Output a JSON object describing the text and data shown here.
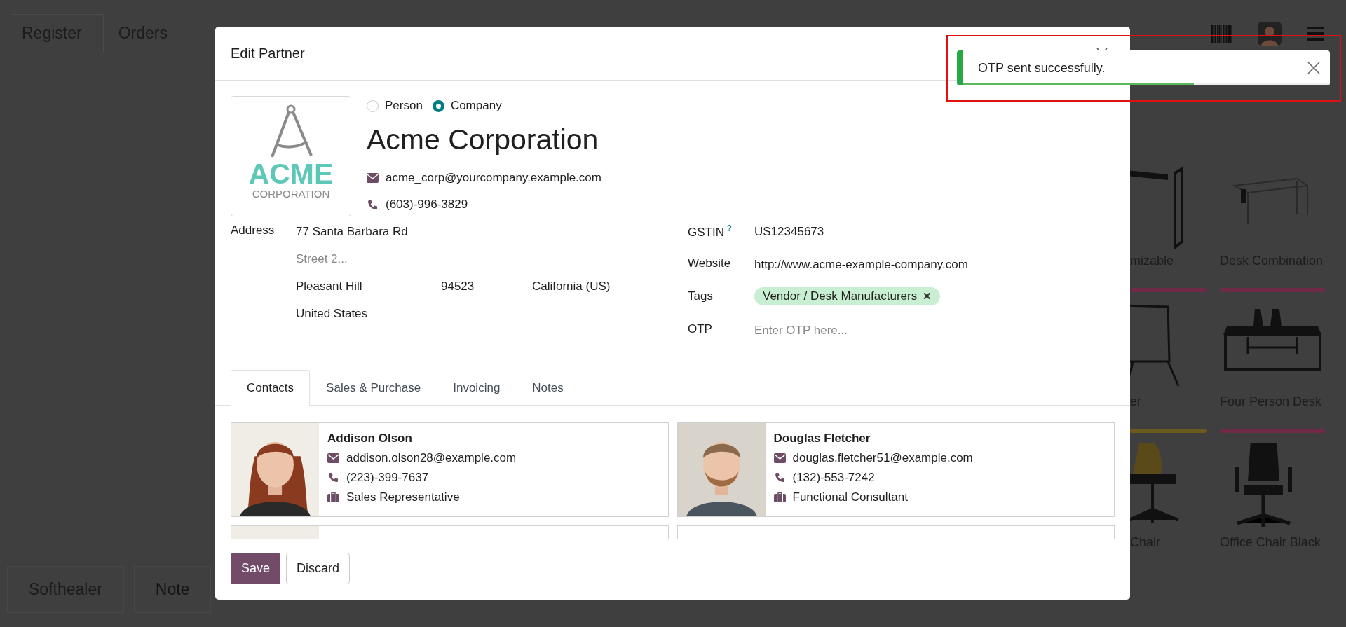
{
  "background": {
    "top_tabs": [
      {
        "label": "Register",
        "selected": true
      },
      {
        "label": "Orders",
        "selected": false
      }
    ],
    "products": [
      {
        "name": "mizable",
        "kind": "frame",
        "color": "#6e2a46"
      },
      {
        "name": "Desk Combination",
        "kind": "desk",
        "color": "#6e2a46"
      },
      {
        "name": "er",
        "kind": "easel",
        "color": "#6b5a1e"
      },
      {
        "name": "Four Person Desk",
        "kind": "bench",
        "color": "#6e2a46"
      },
      {
        "name": "Chair",
        "kind": "chair"
      },
      {
        "name": "Office Chair Black",
        "kind": "office-chair"
      }
    ],
    "bottom_buttons": [
      {
        "label": "Softhealer",
        "kind": "boxed"
      },
      {
        "label": "Note",
        "kind": "muted"
      }
    ]
  },
  "dialog": {
    "title": "Edit Partner",
    "logo": {
      "word": "ACME",
      "sub": "CORPORATION"
    },
    "company_type": [
      {
        "label": "Person",
        "selected": false
      },
      {
        "label": "Company",
        "selected": true
      }
    ],
    "name": "Acme Corporation",
    "email": "acme_corp@yourcompany.example.com",
    "phone": "(603)-996-3829",
    "address": {
      "label": "Address",
      "street": "77 Santa Barbara Rd",
      "street2_placeholder": "Street 2...",
      "city": "Pleasant Hill",
      "zip": "94523",
      "state": "California (US)",
      "country": "United States"
    },
    "gstin": {
      "label": "GSTIN",
      "help": "?",
      "value": "US12345673"
    },
    "website": {
      "label": "Website",
      "value": "http://www.acme-example-company.com"
    },
    "tags": {
      "label": "Tags",
      "items": [
        "Vendor / Desk Manufacturers"
      ],
      "remove": "✕"
    },
    "otp": {
      "label": "OTP",
      "placeholder": "Enter OTP here..."
    },
    "tabs": [
      {
        "label": "Contacts",
        "selected": true
      },
      {
        "label": "Sales & Purchase",
        "selected": false
      },
      {
        "label": "Invoicing",
        "selected": false
      },
      {
        "label": "Notes",
        "selected": false
      }
    ],
    "contacts": [
      {
        "kind": "full",
        "name": "Addison Olson",
        "email": "addison.olson28@example.com",
        "phone": "(223)-399-7637",
        "function": "Sales Representative"
      },
      {
        "kind": "full",
        "name": "Douglas Fletcher",
        "email": "douglas.fletcher51@example.com",
        "phone": "(132)-553-7242",
        "function": "Functional Consultant"
      },
      {
        "kind": "cut",
        "photo": true
      },
      {
        "kind": "cut",
        "photo": false
      }
    ],
    "buttons": [
      {
        "label": "Save",
        "kind": "primary"
      },
      {
        "label": "Discard",
        "kind": "secondary"
      }
    ]
  },
  "toast": {
    "message": "OTP sent successfully.",
    "level": 0.63
  }
}
